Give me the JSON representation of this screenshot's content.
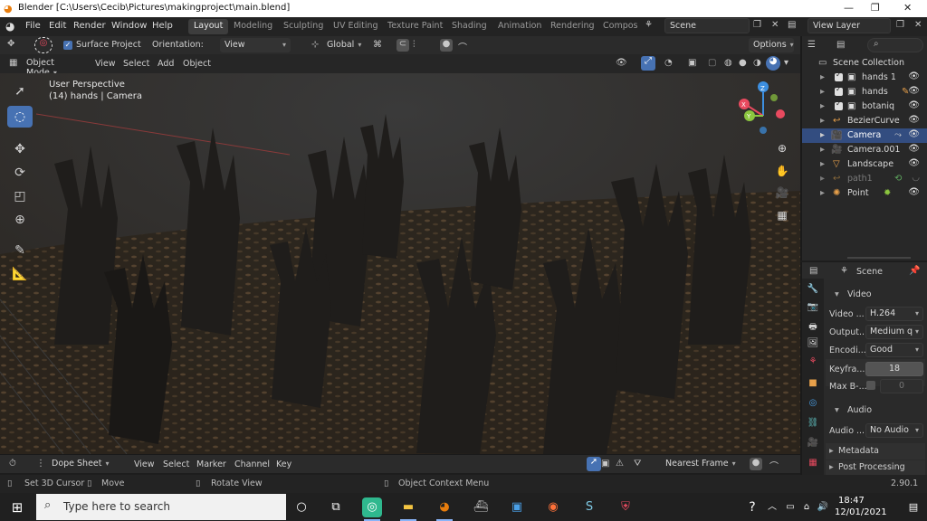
{
  "window": {
    "title": "Blender [C:\\Users\\Cecib\\Pictures\\makingproject\\main.blend]"
  },
  "menu": [
    "File",
    "Edit",
    "Render",
    "Window",
    "Help"
  ],
  "workspaces": [
    {
      "label": "Layout",
      "active": true
    },
    {
      "label": "Modeling"
    },
    {
      "label": "Sculpting"
    },
    {
      "label": "UV Editing"
    },
    {
      "label": "Texture Paint"
    },
    {
      "label": "Shading"
    },
    {
      "label": "Animation"
    },
    {
      "label": "Rendering"
    },
    {
      "label": "Compos"
    }
  ],
  "scene_field": "Scene",
  "view_layer_field": "View Layer",
  "tool_header": {
    "surface_project": "Surface Project",
    "surface_project_checked": true,
    "orientation_label": "Orientation:",
    "orientation_value": "View",
    "transform_orientation": "Global",
    "options": "Options"
  },
  "viewport_header": {
    "mode": "Object Mode",
    "menus": [
      "View",
      "Select",
      "Add",
      "Object"
    ]
  },
  "viewport": {
    "perspective": "User Perspective",
    "context": "(14) hands | Camera"
  },
  "outliner": {
    "root": "Scene Collection",
    "items": [
      {
        "name": "hands 1",
        "icon": "collection-icon",
        "checked": true
      },
      {
        "name": "hands",
        "icon": "collection-icon",
        "checked": true
      },
      {
        "name": "botaniq",
        "icon": "collection-icon",
        "checked": true
      },
      {
        "name": "BezierCurve",
        "icon": "curve-icon"
      },
      {
        "name": "Camera",
        "icon": "camera-icon",
        "selected": true
      },
      {
        "name": "Camera.001",
        "icon": "camera-icon"
      },
      {
        "name": "Landscape",
        "icon": "mesh-icon"
      },
      {
        "name": "path1",
        "icon": "curve-icon",
        "dimmed": true
      },
      {
        "name": "Point",
        "icon": "light-icon"
      }
    ]
  },
  "properties": {
    "context": "Scene",
    "section_video": "Video",
    "rows": [
      {
        "label": "Video ...",
        "value": "H.264"
      },
      {
        "label": "Output...",
        "value": "Medium q"
      },
      {
        "label": "Encodi...",
        "value": "Good"
      },
      {
        "label": "Keyfra...",
        "value": "18"
      },
      {
        "label": "Max B-...",
        "value": "0"
      }
    ],
    "section_audio": "Audio",
    "audio_row": {
      "label": "Audio ...",
      "value": "No Audio"
    },
    "section_metadata": "Metadata",
    "section_postprocessing": "Post Processing"
  },
  "dope_sheet": {
    "editor": "Dope Sheet",
    "menus": [
      "View",
      "Select",
      "Marker",
      "Channel",
      "Key"
    ],
    "snap": "Nearest Frame"
  },
  "statusbar": {
    "left1": "Set 3D Cursor",
    "left2": "Move",
    "left3": "Rotate View",
    "center": "Object Context Menu",
    "version": "2.90.1"
  },
  "taskbar": {
    "search_placeholder": "Type here to search",
    "time": "18:47",
    "date": "12/01/2021"
  },
  "colors": {
    "accent": "#4772b3",
    "selection": "#334d80",
    "axis_x": "#e84a5f",
    "axis_y": "#8cc63f",
    "axis_z": "#3d8fe0"
  }
}
